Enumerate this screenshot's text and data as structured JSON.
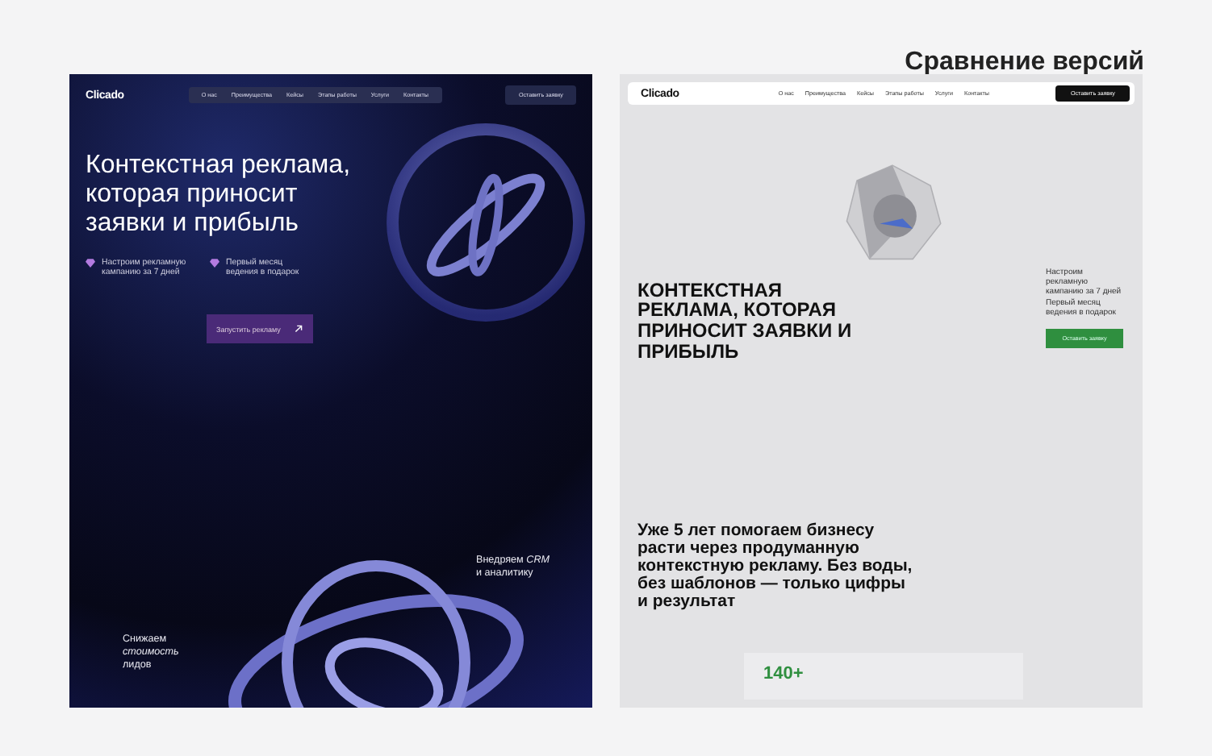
{
  "header": {
    "title": "Сравнение версий"
  },
  "old_version": {
    "logo": "Clicado",
    "nav": [
      "О нас",
      "Преимущества",
      "Кейсы",
      "Этапы работы",
      "Услуги",
      "Контакты"
    ],
    "cta": "Оставить заявку",
    "headline": "Контекстная реклама, которая приносит заявки и прибыль",
    "features": [
      "Настроим рекламную кампанию за 7 дней",
      "Первый месяц ведения в подарок"
    ],
    "button": "Запустить рекламу",
    "bullets": [
      "Внедряем *CRM* и аналитику",
      "Снижаем *стоимость* лидов"
    ]
  },
  "new_version": {
    "logo": "Clicado",
    "nav": [
      "О нас",
      "Преимущества",
      "Кейсы",
      "Этапы работы",
      "Услуги",
      "Контакты"
    ],
    "cta": "Оставить заявку",
    "headline": "КОНТЕКСТНАЯ РЕКЛАМА, КОТОРАЯ ПРИНОСИТ ЗАЯВКИ И ПРИБЫЛЬ",
    "offer": "Настроим рекламную кампанию за 7 дней Первый месяц ведения в подарок",
    "button": "Оставить заявку",
    "intro": "Уже 5 лет помогаем бизнесу расти через продуманную контекстную рекламу. Без воды, без шаблонов — только цифры и результат",
    "stat": "140+"
  }
}
